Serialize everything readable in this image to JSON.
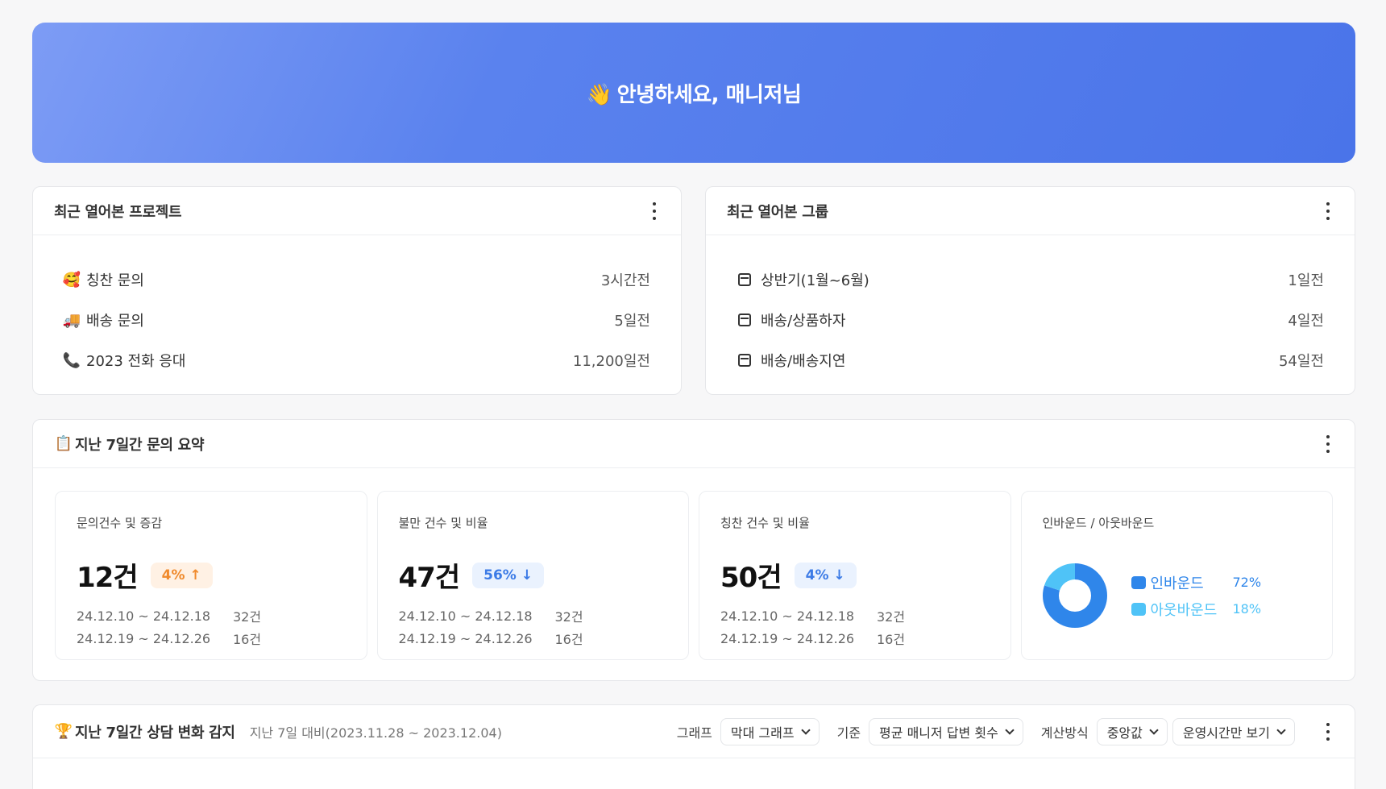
{
  "hero": {
    "emoji": "👋",
    "title": "안녕하세요, 매니저님"
  },
  "projects": {
    "title": "최근 열어본 프로젝트",
    "items": [
      {
        "icon": "🥰",
        "icon_name": "smiling-hearts-icon",
        "label": "칭찬 문의",
        "time": "3시간전"
      },
      {
        "icon": "🚚",
        "icon_name": "truck-icon",
        "label": "배송 문의",
        "time": "5일전"
      },
      {
        "icon": "📞",
        "icon_name": "phone-icon",
        "label": "2023 전화 응대",
        "time": "11,200일전"
      }
    ]
  },
  "groups": {
    "title": "최근 열어본 그룹",
    "items": [
      {
        "label": "상반기(1월~6월)",
        "time": "1일전"
      },
      {
        "label": "배송/상품하자",
        "time": "4일전"
      },
      {
        "label": "배송/배송지연",
        "time": "54일전"
      }
    ]
  },
  "summary": {
    "emoji": "📋",
    "title": "지난 7일간 문의 요약",
    "stats": [
      {
        "label": "문의건수 및 증감",
        "value": "12건",
        "pct": "4%",
        "trend": "up",
        "arrow": "↑",
        "rows": [
          {
            "range": "24.12.10 ~ 24.12.18",
            "count": "32건"
          },
          {
            "range": "24.12.19 ~ 24.12.26",
            "count": "16건"
          }
        ]
      },
      {
        "label": "불만 건수 및 비율",
        "value": "47건",
        "pct": "56%",
        "trend": "down",
        "arrow": "↓",
        "rows": [
          {
            "range": "24.12.10 ~ 24.12.18",
            "count": "32건"
          },
          {
            "range": "24.12.19 ~ 24.12.26",
            "count": "16건"
          }
        ]
      },
      {
        "label": "칭찬 건수 및 비율",
        "value": "50건",
        "pct": "4%",
        "trend": "down",
        "arrow": "↓",
        "rows": [
          {
            "range": "24.12.10 ~ 24.12.18",
            "count": "32건"
          },
          {
            "range": "24.12.19 ~ 24.12.26",
            "count": "16건"
          }
        ]
      }
    ],
    "donut": {
      "label": "인바운드 / 아웃바운드",
      "items": [
        {
          "name": "인바운드",
          "pct": "72%",
          "value": 72,
          "color": "#2f86ea"
        },
        {
          "name": "아웃바운드",
          "pct": "18%",
          "value": 18,
          "color": "#4fc3f7"
        }
      ]
    }
  },
  "changes": {
    "emoji": "🏆",
    "title": "지난 7일간 상담 변화 감지",
    "subtitle": "지난 7일 대비(2023.11.28 ~ 2023.12.04)",
    "filters": {
      "graph_label": "그래프",
      "graph_value": "막대 그래프",
      "basis_label": "기준",
      "basis_value": "평균 매니저 답변 횟수",
      "calc_label": "계산방식",
      "calc_value": "중앙값",
      "hours_value": "운영시간만 보기"
    }
  }
}
